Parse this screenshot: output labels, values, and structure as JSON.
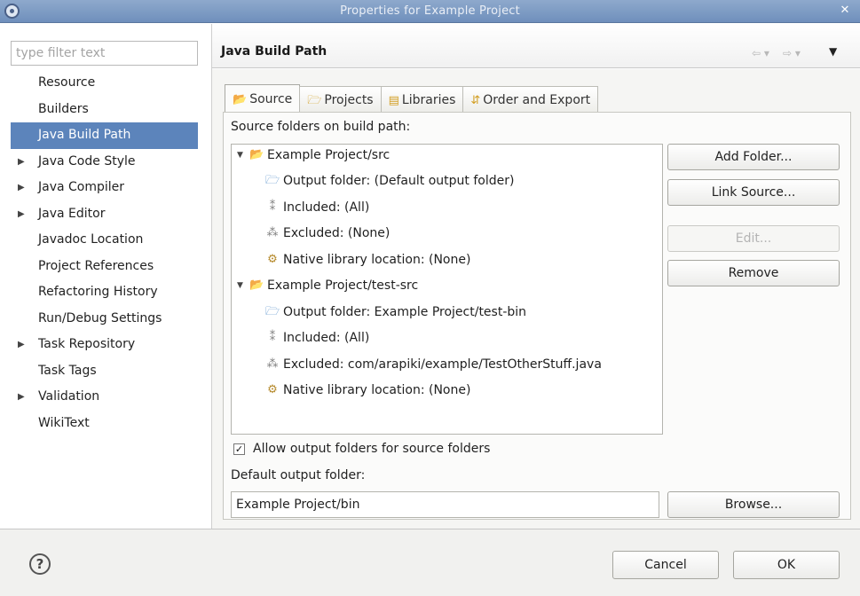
{
  "window": {
    "title": "Properties for Example Project",
    "close_icon": "close-icon"
  },
  "filter": {
    "placeholder": "type filter text",
    "value": ""
  },
  "nav": {
    "items": [
      {
        "label": "Resource",
        "expandable": false
      },
      {
        "label": "Builders",
        "expandable": false
      },
      {
        "label": "Java Build Path",
        "expandable": false,
        "selected": true
      },
      {
        "label": "Java Code Style",
        "expandable": true
      },
      {
        "label": "Java Compiler",
        "expandable": true
      },
      {
        "label": "Java Editor",
        "expandable": true
      },
      {
        "label": "Javadoc Location",
        "expandable": false
      },
      {
        "label": "Project References",
        "expandable": false
      },
      {
        "label": "Refactoring History",
        "expandable": false
      },
      {
        "label": "Run/Debug Settings",
        "expandable": false
      },
      {
        "label": "Task Repository",
        "expandable": true
      },
      {
        "label": "Task Tags",
        "expandable": false
      },
      {
        "label": "Validation",
        "expandable": true
      },
      {
        "label": "WikiText",
        "expandable": false
      }
    ]
  },
  "header": {
    "title": "Java Build Path"
  },
  "tabs": [
    {
      "label": "Source",
      "active": true
    },
    {
      "label": "Projects",
      "active": false
    },
    {
      "label": "Libraries",
      "active": false
    },
    {
      "label": "Order and Export",
      "active": false
    }
  ],
  "source": {
    "tree_label": "Source folders on build path:",
    "tree": [
      {
        "label": "Example Project/src",
        "icon": "folder",
        "level": 0
      },
      {
        "label": "Output folder: (Default output folder)",
        "icon": "output",
        "level": 1
      },
      {
        "label": "Included: (All)",
        "icon": "incl",
        "level": 1
      },
      {
        "label": "Excluded: (None)",
        "icon": "excl",
        "level": 1
      },
      {
        "label": "Native library location: (None)",
        "icon": "native",
        "level": 1
      },
      {
        "label": "Example Project/test-src",
        "icon": "folder",
        "level": 0
      },
      {
        "label": "Output folder: Example Project/test-bin",
        "icon": "output",
        "level": 1
      },
      {
        "label": "Included: (All)",
        "icon": "incl",
        "level": 1
      },
      {
        "label": "Excluded: com/arapiki/example/TestOtherStuff.java",
        "icon": "excl",
        "level": 1
      },
      {
        "label": "Native library location: (None)",
        "icon": "native",
        "level": 1
      }
    ],
    "buttons": {
      "add_folder": "Add Folder...",
      "link_source": "Link Source...",
      "edit": "Edit...",
      "remove": "Remove"
    },
    "allow_output_label": "Allow output folders for source folders",
    "allow_output_checked": true,
    "default_output_label": "Default output folder:",
    "default_output_value": "Example Project/bin",
    "browse": "Browse..."
  },
  "footer": {
    "cancel": "Cancel",
    "ok": "OK",
    "help_glyph": "?"
  }
}
